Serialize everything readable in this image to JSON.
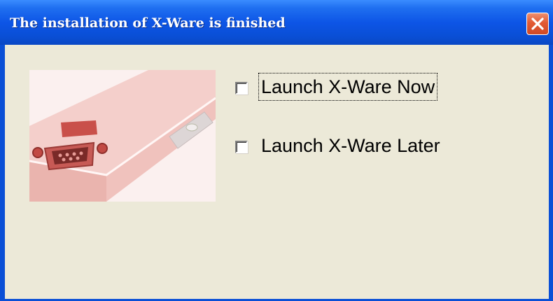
{
  "window": {
    "title": "The installation of X-Ware is finished",
    "close_icon": "close-x-icon",
    "accent_color": "#0a4fd6",
    "close_color": "#e25a34"
  },
  "dialog": {
    "image_subject": "serial-port-device-photo",
    "options": [
      {
        "label": "Launch X-Ware Now",
        "checked": false,
        "focused": true
      },
      {
        "label": "Launch X-Ware Later",
        "checked": false,
        "focused": false
      }
    ]
  }
}
